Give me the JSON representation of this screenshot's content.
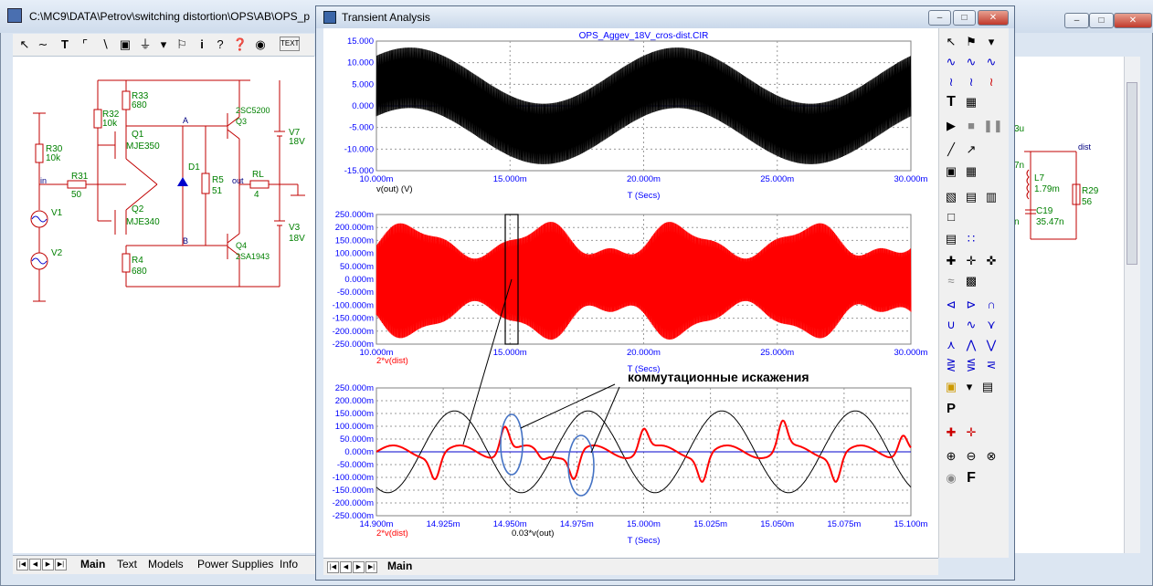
{
  "outer_window": {
    "title": "C:\\MC9\\DATA\\Petrov\\switching distortion\\OPS\\AB\\OPS_p",
    "bottom_tabs": [
      "Main",
      "Text",
      "Models",
      "Power Supplies",
      "Info"
    ]
  },
  "schematic": {
    "labels": {
      "r30": "R30",
      "r30v": "10k",
      "r31": "R31",
      "r31v": "50",
      "r32": "R32",
      "r32v": "10k",
      "r33": "R33",
      "r33v": "680",
      "r4": "R4",
      "r4v": "680",
      "r5": "R5",
      "r5v": "51",
      "rl": "RL",
      "rlv": "4",
      "q1": "Q1",
      "q1t": "MJE350",
      "q2": "Q2",
      "q2t": "MJE340",
      "q3": "Q3",
      "q3t": "2SC5200",
      "q4": "Q4",
      "q4t": "2SA1943",
      "d1": "D1",
      "v1": "V1",
      "v2": "V2",
      "v7": "V7",
      "v7v": "18V",
      "v3": "V3",
      "v3v": "18V",
      "in": "in",
      "out": "out",
      "A": "A",
      "B": "B",
      "l7": "L7",
      "l7v": "1.79m",
      "c19": "C19",
      "c19v": "35.47n",
      "r29": "R29",
      "r29v": "56",
      "dist": "dist",
      "cap_frag": "3u",
      "cap_frag2": "n",
      "cap_frag3": "7n"
    }
  },
  "transient": {
    "title": "Transient Analysis",
    "main_tab": "Main",
    "plot_title": "OPS_Aggev_18V_cros-dist.CIR",
    "annotation": "коммутационные искажения",
    "plot1": {
      "yticks": [
        "15.000",
        "10.000",
        "5.000",
        "0.000",
        "-5.000",
        "-10.000",
        "-15.000"
      ],
      "xticks": [
        "10.000m",
        "15.000m",
        "20.000m",
        "25.000m",
        "30.000m"
      ],
      "xlabel": "T (Secs)",
      "trace": "v(out) (V)"
    },
    "plot2": {
      "yticks": [
        "250.000m",
        "200.000m",
        "150.000m",
        "100.000m",
        "50.000m",
        "0.000m",
        "-50.000m",
        "-100.000m",
        "-150.000m",
        "-200.000m",
        "-250.000m"
      ],
      "xticks": [
        "10.000m",
        "15.000m",
        "20.000m",
        "25.000m",
        "30.000m"
      ],
      "xlabel": "T (Secs)",
      "trace": "2*v(dist)"
    },
    "plot3": {
      "yticks": [
        "250.000m",
        "200.000m",
        "150.000m",
        "100.000m",
        "50.000m",
        "0.000m",
        "-50.000m",
        "-100.000m",
        "-150.000m",
        "-200.000m",
        "-250.000m"
      ],
      "xticks": [
        "14.900m",
        "14.925m",
        "14.950m",
        "14.975m",
        "15.000m",
        "15.025m",
        "15.050m",
        "15.075m",
        "15.100m"
      ],
      "xlabel": "T (Secs)",
      "trace1": "2*v(dist)",
      "trace2": "0.03*v(out)"
    }
  },
  "colors": {
    "trace_black": "#000000",
    "trace_red": "#ff0000",
    "axis_blue": "#0000ff",
    "schematic_green": "#008000",
    "schematic_red": "#c00000"
  }
}
